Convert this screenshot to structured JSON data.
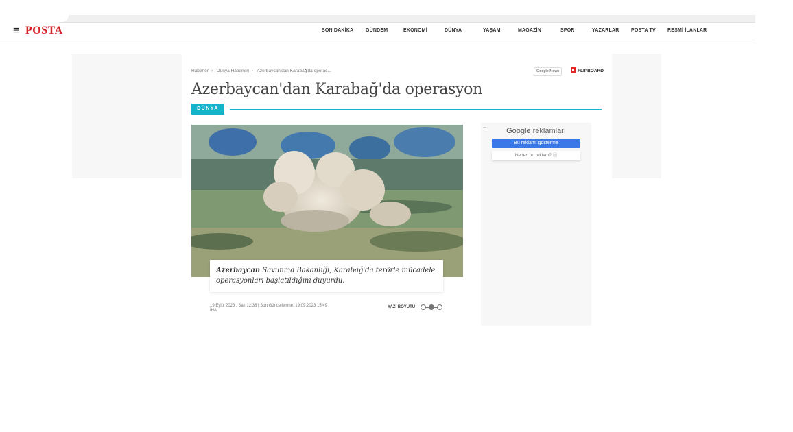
{
  "header": {
    "logo_text": "POSTA",
    "menu_icon": "hamburger-menu-icon",
    "nav": [
      {
        "label": "SON DAKİKA"
      },
      {
        "label": "GÜNDEM"
      },
      {
        "label": "EKONOMİ"
      },
      {
        "label": "DÜNYA"
      },
      {
        "label": "YAŞAM"
      },
      {
        "label": "MAGAZİN"
      },
      {
        "label": "SPOR"
      },
      {
        "label": "YAZARLAR"
      },
      {
        "label": "POSTA TV"
      },
      {
        "label": "RESMİ İLANLAR"
      }
    ]
  },
  "article": {
    "breadcrumb": [
      {
        "label": "Haberler"
      },
      {
        "label": "Dünya Haberleri"
      },
      {
        "label": "Azerbaycan'dan Karabağ'da operas..."
      }
    ],
    "breadcrumb_separator": "›",
    "google_news": "Google News",
    "flipboard": "FLIPBOARD",
    "title": "Azerbaycan'dan Karabağ'da operasyon",
    "category": "DÜNYA",
    "caption_bold": "Azerbaycan",
    "caption_rest": " Savunma Bakanlığı, Karabağ'da terörle mücadele operasyonları başlatıldığını duyurdu.",
    "date_line": "19 Eylül 2023 , Salı 12:38 | Son Güncellenme: 19.09.2023 15:49",
    "source": "İHA",
    "font_size_label": "YAZI BOYUTU",
    "font_size_level": 2
  },
  "ad": {
    "back_icon": "arrow-left-icon",
    "title_brand": "Google",
    "title_rest": " reklamları",
    "hide_button": "Bu reklamı gösterme",
    "why_button": "Neden bu reklam? ⓘ"
  },
  "colors": {
    "brand_red": "#d8232a",
    "accent_teal": "#15b3c9",
    "ad_button_blue": "#3b78e7"
  }
}
